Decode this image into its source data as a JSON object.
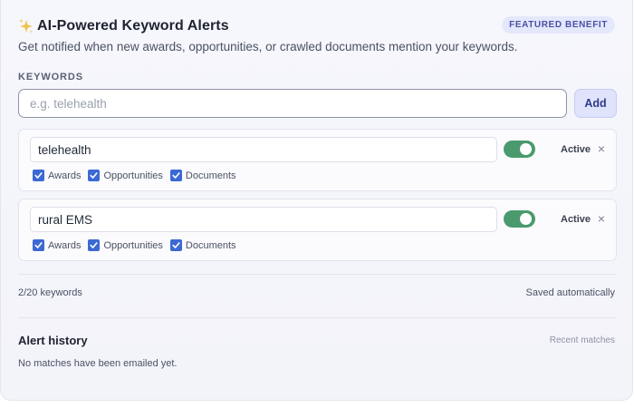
{
  "header": {
    "icon": "sparkles-icon",
    "title": "AI-Powered Keyword Alerts",
    "badge": "FEATURED BENEFIT",
    "subtitle": "Get notified when new awards, opportunities, or crawled documents mention your keywords."
  },
  "keywords_section": {
    "label": "KEYWORDS",
    "input_value": "",
    "input_placeholder": "e.g. telehealth",
    "add_label": "Add"
  },
  "keywords": [
    {
      "value": "telehealth",
      "enabled": true,
      "status": "Active",
      "remove_icon": "close-icon",
      "sources": [
        {
          "label": "Awards",
          "checked": true
        },
        {
          "label": "Opportunities",
          "checked": true
        },
        {
          "label": "Documents",
          "checked": true
        }
      ]
    },
    {
      "value": "rural EMS",
      "enabled": true,
      "status": "Active",
      "remove_icon": "close-icon",
      "sources": [
        {
          "label": "Awards",
          "checked": true
        },
        {
          "label": "Opportunities",
          "checked": true
        },
        {
          "label": "Documents",
          "checked": true
        }
      ]
    }
  ],
  "footer": {
    "count": "2/20 keywords",
    "saved": "Saved automatically"
  },
  "history": {
    "title": "Alert history",
    "recent_label": "Recent matches",
    "empty_text": "No matches have been emailed yet."
  },
  "colors": {
    "accent": "#3c69d3",
    "toggle_on": "#4a9a6d",
    "badge_bg": "#e5e8fb",
    "badge_text": "#4851a6"
  }
}
